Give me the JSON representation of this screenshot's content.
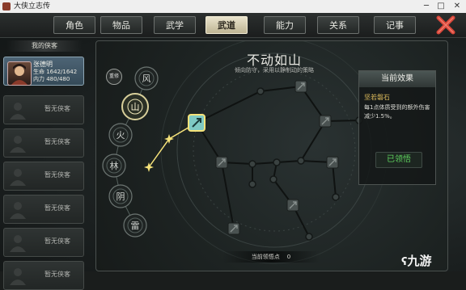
{
  "window": {
    "title": "大侠立志传",
    "minimize_glyph": "─",
    "maximize_glyph": "□",
    "close_glyph": "✕"
  },
  "tabs": [
    {
      "label": "角色",
      "active": false
    },
    {
      "label": "物品",
      "active": false
    },
    {
      "label": "武学",
      "active": false
    },
    {
      "label": "武道",
      "active": true
    },
    {
      "label": "能力",
      "active": false
    },
    {
      "label": "关系",
      "active": false
    },
    {
      "label": "记事",
      "active": false
    }
  ],
  "sidebar": {
    "header": "我的侠客",
    "character": {
      "name": "张德明",
      "hp": "生命 1642/1642",
      "mp": "内力 480/480"
    },
    "empty_label": "暂无侠客",
    "empty_count": 6
  },
  "realm_label": "重修",
  "stances": [
    "风",
    "山",
    "火",
    "林",
    "阴",
    "雷"
  ],
  "selected_stance": "山",
  "panel": {
    "title": "不动如山",
    "subtitle": "倾向防守，采用以静制动的策略"
  },
  "effect": {
    "header": "当前效果",
    "name": "坚若磐石",
    "description": "每1点体质受到的额外伤害减少1.5%。",
    "status": "已领悟"
  },
  "points": {
    "label": "当前领悟点",
    "value": "0"
  },
  "watermark": "九游",
  "colors": {
    "active_tab": "#e9e3cc",
    "learned_green": "#5fd35f",
    "effect_name_gold": "#d9b85a",
    "close_red": "#d9463a",
    "star_yellow": "#f5e27a"
  }
}
